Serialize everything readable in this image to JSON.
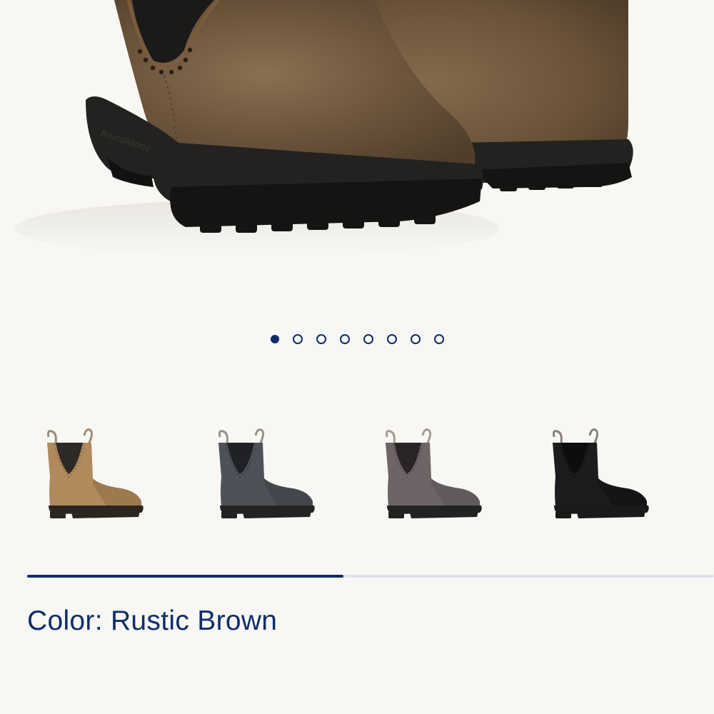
{
  "gallery": {
    "image_count": 8,
    "active_index": 0,
    "current_image": "Rustic Brown boot pair, close-up"
  },
  "swatches": [
    {
      "name": "Rustic Brown",
      "upper": "#b08a5c",
      "shade": "#8e6c45",
      "sole": "#2b2620",
      "gore": "#2d2a26",
      "tab": "#a08b74",
      "selected": true
    },
    {
      "name": "Steel Grey",
      "upper": "#4d5259",
      "shade": "#3a3e44",
      "sole": "#232323",
      "gore": "#1f2124",
      "tab": "#9a9088",
      "selected": false
    },
    {
      "name": "Grey",
      "upper": "#6e6466",
      "shade": "#585053",
      "sole": "#222",
      "gore": "#2a2426",
      "tab": "#a89a92",
      "selected": false
    },
    {
      "name": "Black",
      "upper": "#1c1c1e",
      "shade": "#111",
      "sole": "#1a1a1a",
      "gore": "#0d0d0d",
      "tab": "#8a8078",
      "selected": false
    }
  ],
  "scroll": {
    "progress": 0.46
  },
  "color": {
    "label": "Color:",
    "value": "Rustic Brown",
    "text": "Color: Rustic Brown"
  },
  "colors": {
    "accent": "#0d2e6b",
    "background": "#f8f7f3",
    "track": "#e1e2ea"
  }
}
